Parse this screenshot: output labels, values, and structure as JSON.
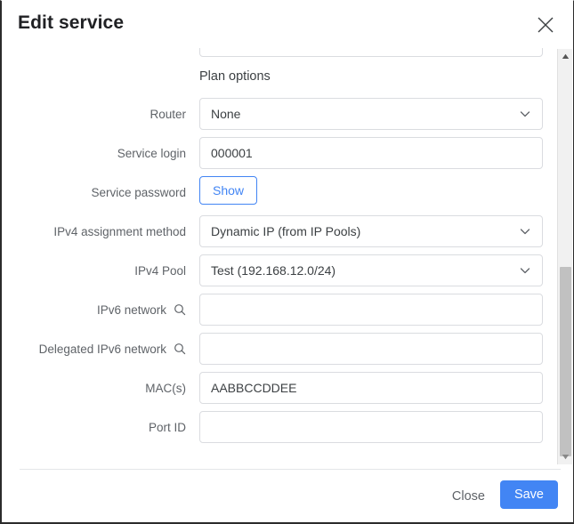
{
  "dialog": {
    "title": "Edit service",
    "close_icon": "close-icon"
  },
  "form": {
    "section_heading": "Plan options",
    "fields": [
      {
        "label": "Router",
        "type": "select",
        "value": "None",
        "name": "router"
      },
      {
        "label": "Service login",
        "type": "text",
        "value": "000001",
        "placeholder": "",
        "name": "service-login"
      },
      {
        "label": "Service password",
        "type": "button",
        "value": "Show",
        "name": "service-password"
      },
      {
        "label": "IPv4 assignment method",
        "type": "select",
        "value": "Dynamic IP (from IP Pools)",
        "name": "ipv4-assignment-method"
      },
      {
        "label": "IPv4 Pool",
        "type": "select",
        "value": "Test (192.168.12.0/24)",
        "name": "ipv4-pool"
      },
      {
        "label": "IPv6 network",
        "type": "text",
        "value": "",
        "placeholder": "",
        "icon": "search-icon",
        "name": "ipv6-network"
      },
      {
        "label": "Delegated IPv6 network",
        "type": "text",
        "value": "",
        "placeholder": "",
        "icon": "search-icon",
        "name": "delegated-ipv6-network"
      },
      {
        "label": "MAC(s)",
        "type": "text",
        "value": "AABBCCDDEE",
        "placeholder": "",
        "name": "macs"
      },
      {
        "label": "Port ID",
        "type": "text",
        "value": "",
        "placeholder": "",
        "name": "port-id"
      }
    ]
  },
  "footer": {
    "close_label": "Close",
    "save_label": "Save"
  },
  "colors": {
    "accent": "#4285f4",
    "label": "#5f6368",
    "text": "#3c4043",
    "border": "#dadce0",
    "scrollbar_thumb": "#c1c1c1"
  }
}
